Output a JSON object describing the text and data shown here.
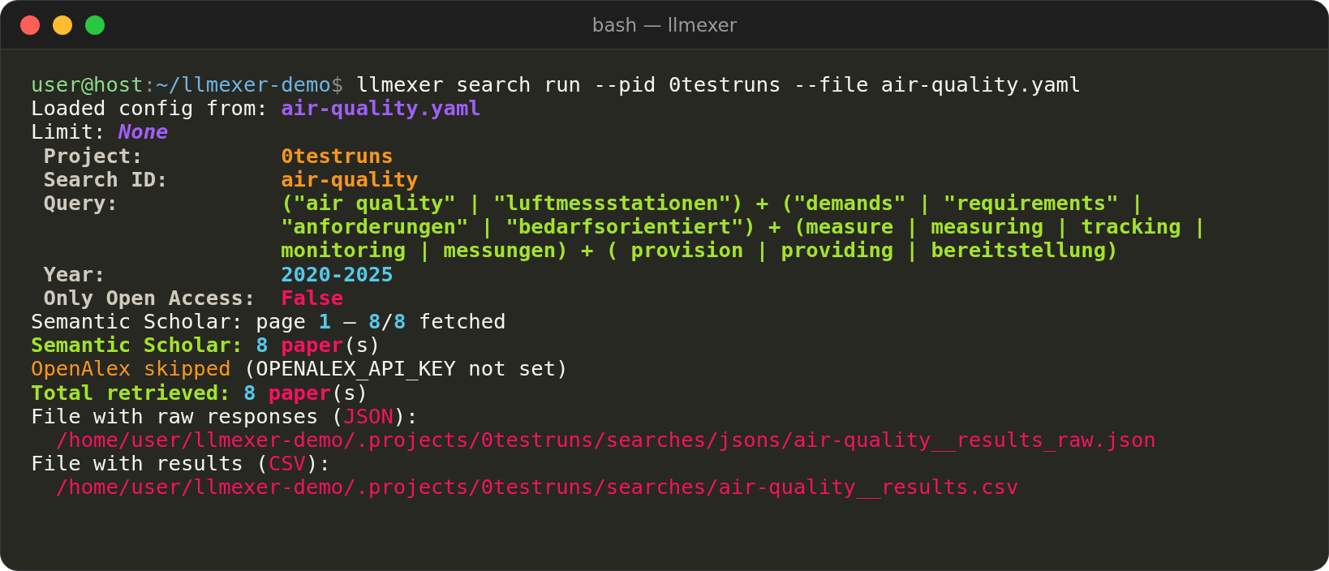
{
  "window": {
    "title": "bash — llmexer"
  },
  "lines": [
    {
      "kind": "line",
      "segments": [
        {
          "text": "user@host",
          "color": "#8cd98a",
          "bold": false,
          "italic": false
        },
        {
          "text": ":",
          "color": "#8a8a8a",
          "bold": false,
          "italic": false
        },
        {
          "text": "~/llmexer-demo",
          "color": "#6fb3e3",
          "bold": false,
          "italic": false
        },
        {
          "text": "$",
          "color": "#8a8a8a",
          "bold": false,
          "italic": false
        },
        {
          "text": " llmexer search run --pid 0testruns --file air-quality.yaml",
          "color": "#f4f4f0",
          "bold": false,
          "italic": false
        }
      ]
    },
    {
      "kind": "line",
      "segments": [
        {
          "text": "Loaded config from: ",
          "color": "#f4f4f0",
          "bold": false,
          "italic": false
        },
        {
          "text": "air-quality.yaml",
          "color": "#a15ff5",
          "bold": true,
          "italic": false
        }
      ]
    },
    {
      "kind": "line",
      "segments": [
        {
          "text": "Limit: ",
          "color": "#f4f4f0",
          "bold": false,
          "italic": false
        },
        {
          "text": "None",
          "color": "#a15ff5",
          "bold": true,
          "italic": true
        }
      ]
    },
    {
      "kind": "field",
      "label": "Project:",
      "value": {
        "text": "0testruns",
        "color": "#f7961e"
      }
    },
    {
      "kind": "field",
      "label": "Search ID:",
      "value": {
        "text": "air-quality",
        "color": "#f7961e"
      }
    },
    {
      "kind": "field",
      "label": "Query:",
      "value": {
        "text": "(\"air quality\" | \"luftmessstationen\") + (\"demands\" | \"requirements\" | \"anforderungen\" | \"bedarfsorientiert\") + (measure | measuring | tracking | monitoring | messungen) + ( provision | providing | bereitstellung)",
        "color": "#a3e22e"
      }
    },
    {
      "kind": "field",
      "label": "Year:",
      "value": {
        "text": "2020-2025",
        "color": "#56c8e8"
      }
    },
    {
      "kind": "field",
      "label": "Only Open Access:",
      "value": {
        "text": "False",
        "color": "#f5135e"
      }
    },
    {
      "kind": "line",
      "segments": [
        {
          "text": "Semantic Scholar: page ",
          "color": "#f4f4f0",
          "bold": false,
          "italic": false
        },
        {
          "text": "1",
          "color": "#56c8e8",
          "bold": true,
          "italic": false
        },
        {
          "text": " — ",
          "color": "#f4f4f0",
          "bold": false,
          "italic": false
        },
        {
          "text": "8",
          "color": "#56c8e8",
          "bold": true,
          "italic": false
        },
        {
          "text": "/",
          "color": "#f4f4f0",
          "bold": false,
          "italic": false
        },
        {
          "text": "8",
          "color": "#56c8e8",
          "bold": true,
          "italic": false
        },
        {
          "text": " fetched",
          "color": "#f4f4f0",
          "bold": false,
          "italic": false
        }
      ]
    },
    {
      "kind": "line",
      "segments": [
        {
          "text": "Semantic Scholar: ",
          "color": "#a3e22e",
          "bold": true,
          "italic": false
        },
        {
          "text": "8 ",
          "color": "#56c8e8",
          "bold": true,
          "italic": false
        },
        {
          "text": "paper",
          "color": "#f5135e",
          "bold": true,
          "italic": false
        },
        {
          "text": "(s)",
          "color": "#f4f4f0",
          "bold": false,
          "italic": false
        }
      ]
    },
    {
      "kind": "line",
      "segments": [
        {
          "text": "OpenAlex skipped",
          "color": "#f7961e",
          "bold": false,
          "italic": false
        },
        {
          "text": " (OPENALEX_API_KEY not set)",
          "color": "#f4f4f0",
          "bold": false,
          "italic": false
        }
      ]
    },
    {
      "kind": "line",
      "segments": [
        {
          "text": "Total retrieved: ",
          "color": "#a3e22e",
          "bold": true,
          "italic": false
        },
        {
          "text": "8 ",
          "color": "#56c8e8",
          "bold": true,
          "italic": false
        },
        {
          "text": "paper",
          "color": "#f5135e",
          "bold": true,
          "italic": false
        },
        {
          "text": "(s)",
          "color": "#f4f4f0",
          "bold": false,
          "italic": false
        }
      ]
    },
    {
      "kind": "line",
      "segments": [
        {
          "text": "File with raw responses (",
          "color": "#f4f4f0",
          "bold": false,
          "italic": false
        },
        {
          "text": "JSON",
          "color": "#f5135e",
          "bold": false,
          "italic": false
        },
        {
          "text": "):",
          "color": "#f4f4f0",
          "bold": false,
          "italic": false
        }
      ]
    },
    {
      "kind": "path",
      "segments": [
        {
          "text": "/home/user/llmexer-demo/.projects/0testruns/searches/jsons/air-quality__results_raw.json",
          "color": "#f5135e",
          "bold": false,
          "italic": false
        }
      ]
    },
    {
      "kind": "line",
      "segments": [
        {
          "text": "File with results (",
          "color": "#f4f4f0",
          "bold": false,
          "italic": false
        },
        {
          "text": "CSV",
          "color": "#f5135e",
          "bold": false,
          "italic": false
        },
        {
          "text": "):",
          "color": "#f4f4f0",
          "bold": false,
          "italic": false
        }
      ]
    },
    {
      "kind": "path",
      "segments": [
        {
          "text": "/home/user/llmexer-demo/.projects/0testruns/searches/air-quality__results.csv",
          "color": "#f5135e",
          "bold": false,
          "italic": false
        }
      ]
    }
  ]
}
